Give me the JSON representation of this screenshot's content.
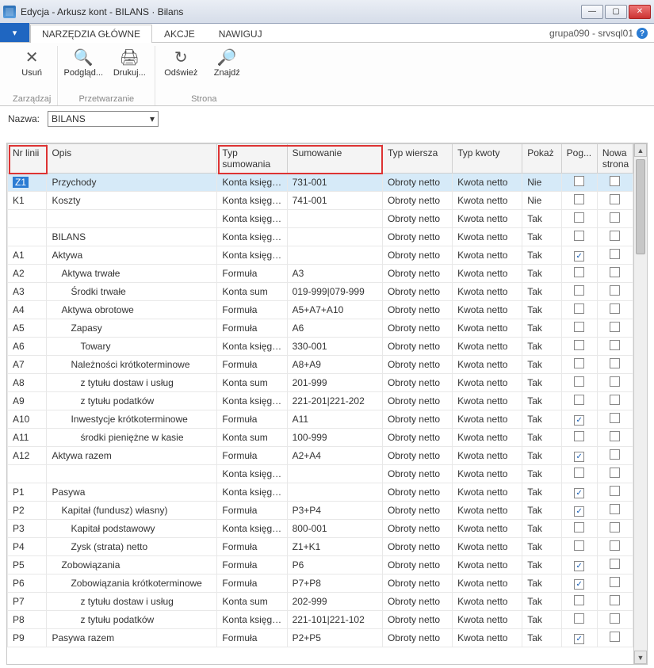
{
  "window": {
    "title": "Edycja - Arkusz kont - BILANS · Bilans"
  },
  "tabs": {
    "file_glyph": "▾",
    "items": [
      "NARZĘDZIA GŁÓWNE",
      "AKCJE",
      "NAWIGUJ"
    ],
    "active_index": 0
  },
  "userinfo": "grupa090 - srvsql01",
  "ribbon": {
    "groups": [
      {
        "label": "Zarządzaj",
        "buttons": [
          {
            "name": "usun-button",
            "icon": "✕",
            "label": "Usuń"
          }
        ]
      },
      {
        "label": "Przetwarzanie",
        "buttons": [
          {
            "name": "podglad-button",
            "icon": "🔍",
            "label": "Podgląd..."
          },
          {
            "name": "drukuj-button",
            "icon": "🖨",
            "label": "Drukuj..."
          }
        ]
      },
      {
        "label": "Strona",
        "buttons": [
          {
            "name": "odswiez-button",
            "icon": "↻",
            "label": "Odśwież"
          },
          {
            "name": "znajdz-button",
            "icon": "🔎",
            "label": "Znajdź"
          }
        ]
      }
    ]
  },
  "namerow": {
    "label": "Nazwa:",
    "value": "BILANS"
  },
  "columns": {
    "nr": "Nr linii",
    "opis": "Opis",
    "typs": "Typ sumowania",
    "sum": "Sumowanie",
    "tw": "Typ wiersza",
    "tk": "Typ kwoty",
    "pokaz": "Pokaż",
    "pog": "Pog...",
    "nowa": "Nowa strona"
  },
  "rows": [
    {
      "nr": "Z1",
      "opis": "Przychody",
      "indent": 0,
      "typs": "Konta księgo...",
      "sum": "731-001",
      "tw": "Obroty netto",
      "tk": "Kwota netto",
      "pokaz": "Nie",
      "pog": false,
      "nowa": false,
      "selected": true,
      "nr_sel": true
    },
    {
      "nr": "K1",
      "opis": "Koszty",
      "indent": 0,
      "typs": "Konta księgo...",
      "sum": "741-001",
      "tw": "Obroty netto",
      "tk": "Kwota netto",
      "pokaz": "Nie",
      "pog": false,
      "nowa": false
    },
    {
      "nr": "",
      "opis": "",
      "indent": 0,
      "typs": "Konta księgo...",
      "sum": "",
      "tw": "Obroty netto",
      "tk": "Kwota netto",
      "pokaz": "Tak",
      "pog": false,
      "nowa": false
    },
    {
      "nr": "",
      "opis": "BILANS",
      "indent": 0,
      "typs": "Konta księgo...",
      "sum": "",
      "tw": "Obroty netto",
      "tk": "Kwota netto",
      "pokaz": "Tak",
      "pog": false,
      "nowa": false
    },
    {
      "nr": "A1",
      "opis": "Aktywa",
      "indent": 0,
      "typs": "Konta księgo...",
      "sum": "",
      "tw": "Obroty netto",
      "tk": "Kwota netto",
      "pokaz": "Tak",
      "pog": true,
      "nowa": false
    },
    {
      "nr": "A2",
      "opis": "Aktywa trwałe",
      "indent": 1,
      "typs": "Formuła",
      "sum": "A3",
      "tw": "Obroty netto",
      "tk": "Kwota netto",
      "pokaz": "Tak",
      "pog": false,
      "nowa": false
    },
    {
      "nr": "A3",
      "opis": "Środki trwałe",
      "indent": 2,
      "typs": "Konta sum",
      "sum": "019-999|079-999",
      "tw": "Obroty netto",
      "tk": "Kwota netto",
      "pokaz": "Tak",
      "pog": false,
      "nowa": false
    },
    {
      "nr": "A4",
      "opis": "Aktywa obrotowe",
      "indent": 1,
      "typs": "Formuła",
      "sum": "A5+A7+A10",
      "tw": "Obroty netto",
      "tk": "Kwota netto",
      "pokaz": "Tak",
      "pog": false,
      "nowa": false
    },
    {
      "nr": "A5",
      "opis": "Zapasy",
      "indent": 2,
      "typs": "Formuła",
      "sum": "A6",
      "tw": "Obroty netto",
      "tk": "Kwota netto",
      "pokaz": "Tak",
      "pog": false,
      "nowa": false
    },
    {
      "nr": "A6",
      "opis": "Towary",
      "indent": 3,
      "typs": "Konta księgo...",
      "sum": "330-001",
      "tw": "Obroty netto",
      "tk": "Kwota netto",
      "pokaz": "Tak",
      "pog": false,
      "nowa": false
    },
    {
      "nr": "A7",
      "opis": "Należności krótkoterminowe",
      "indent": 2,
      "typs": "Formuła",
      "sum": "A8+A9",
      "tw": "Obroty netto",
      "tk": "Kwota netto",
      "pokaz": "Tak",
      "pog": false,
      "nowa": false
    },
    {
      "nr": "A8",
      "opis": "z tytułu dostaw i usług",
      "indent": 3,
      "typs": "Konta sum",
      "sum": "201-999",
      "tw": "Obroty netto",
      "tk": "Kwota netto",
      "pokaz": "Tak",
      "pog": false,
      "nowa": false
    },
    {
      "nr": "A9",
      "opis": "z tytułu podatków",
      "indent": 3,
      "typs": "Konta księgo...",
      "sum": "221-201|221-202",
      "tw": "Obroty netto",
      "tk": "Kwota netto",
      "pokaz": "Tak",
      "pog": false,
      "nowa": false
    },
    {
      "nr": "A10",
      "opis": "Inwestycje krótkoterminowe",
      "indent": 2,
      "typs": "Formuła",
      "sum": "A11",
      "tw": "Obroty netto",
      "tk": "Kwota netto",
      "pokaz": "Tak",
      "pog": true,
      "nowa": false
    },
    {
      "nr": "A11",
      "opis": "środki pieniężne w kasie",
      "indent": 3,
      "typs": "Konta sum",
      "sum": "100-999",
      "tw": "Obroty netto",
      "tk": "Kwota netto",
      "pokaz": "Tak",
      "pog": false,
      "nowa": false
    },
    {
      "nr": "A12",
      "opis": "Aktywa razem",
      "indent": 0,
      "typs": "Formuła",
      "sum": "A2+A4",
      "tw": "Obroty netto",
      "tk": "Kwota netto",
      "pokaz": "Tak",
      "pog": true,
      "nowa": false
    },
    {
      "nr": "",
      "opis": "",
      "indent": 0,
      "typs": "Konta księgo...",
      "sum": "",
      "tw": "Obroty netto",
      "tk": "Kwota netto",
      "pokaz": "Tak",
      "pog": false,
      "nowa": false
    },
    {
      "nr": "P1",
      "opis": "Pasywa",
      "indent": 0,
      "typs": "Konta księgo...",
      "sum": "",
      "tw": "Obroty netto",
      "tk": "Kwota netto",
      "pokaz": "Tak",
      "pog": true,
      "nowa": false
    },
    {
      "nr": "P2",
      "opis": "Kapitał (fundusz) własny)",
      "indent": 1,
      "typs": "Formuła",
      "sum": "P3+P4",
      "tw": "Obroty netto",
      "tk": "Kwota netto",
      "pokaz": "Tak",
      "pog": true,
      "nowa": false
    },
    {
      "nr": "P3",
      "opis": "Kapitał podstawowy",
      "indent": 2,
      "typs": "Konta księgo...",
      "sum": "800-001",
      "tw": "Obroty netto",
      "tk": "Kwota netto",
      "pokaz": "Tak",
      "pog": false,
      "nowa": false
    },
    {
      "nr": "P4",
      "opis": "Zysk (strata) netto",
      "indent": 2,
      "typs": "Formuła",
      "sum": "Z1+K1",
      "tw": "Obroty netto",
      "tk": "Kwota netto",
      "pokaz": "Tak",
      "pog": false,
      "nowa": false
    },
    {
      "nr": "P5",
      "opis": "Zobowiązania",
      "indent": 1,
      "typs": "Formuła",
      "sum": "P6",
      "tw": "Obroty netto",
      "tk": "Kwota netto",
      "pokaz": "Tak",
      "pog": true,
      "nowa": false
    },
    {
      "nr": "P6",
      "opis": "Zobowiązania krótkoterminowe",
      "indent": 2,
      "typs": "Formuła",
      "sum": "P7+P8",
      "tw": "Obroty netto",
      "tk": "Kwota netto",
      "pokaz": "Tak",
      "pog": true,
      "nowa": false
    },
    {
      "nr": "P7",
      "opis": "z tytułu dostaw i usług",
      "indent": 3,
      "typs": "Konta sum",
      "sum": "202-999",
      "tw": "Obroty netto",
      "tk": "Kwota netto",
      "pokaz": "Tak",
      "pog": false,
      "nowa": false
    },
    {
      "nr": "P8",
      "opis": "z tytułu podatków",
      "indent": 3,
      "typs": "Konta księgo...",
      "sum": "221-101|221-102",
      "tw": "Obroty netto",
      "tk": "Kwota netto",
      "pokaz": "Tak",
      "pog": false,
      "nowa": false
    },
    {
      "nr": "P9",
      "opis": "Pasywa razem",
      "indent": 0,
      "typs": "Formuła",
      "sum": "P2+P5",
      "tw": "Obroty netto",
      "tk": "Kwota netto",
      "pokaz": "Tak",
      "pog": true,
      "nowa": false
    }
  ]
}
